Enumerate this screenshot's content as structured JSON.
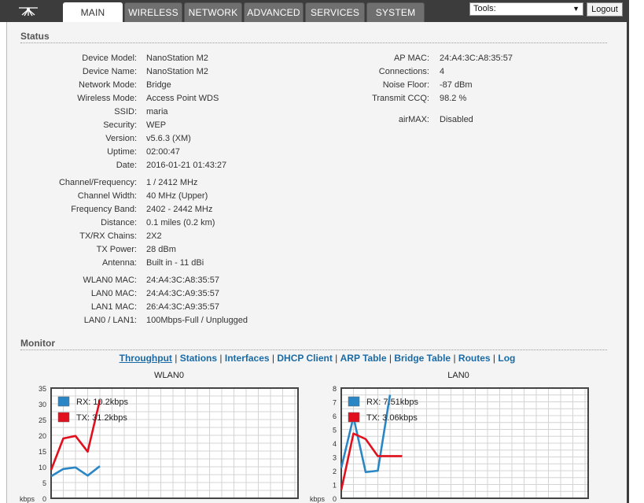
{
  "nav": {
    "tabs": [
      {
        "label": "MAIN",
        "active": true
      },
      {
        "label": "WIRELESS",
        "active": false
      },
      {
        "label": "NETWORK",
        "active": false
      },
      {
        "label": "ADVANCED",
        "active": false
      },
      {
        "label": "SERVICES",
        "active": false
      },
      {
        "label": "SYSTEM",
        "active": false
      }
    ],
    "tools_selected": "Tools:",
    "logout_label": "Logout"
  },
  "status": {
    "title": "Status",
    "left_group1": [
      {
        "label": "Device Model:",
        "value": "NanoStation M2"
      },
      {
        "label": "Device Name:",
        "value": "NanoStation M2"
      },
      {
        "label": "Network Mode:",
        "value": "Bridge"
      },
      {
        "label": "Wireless Mode:",
        "value": "Access Point WDS"
      },
      {
        "label": "SSID:",
        "value": "maria"
      },
      {
        "label": "Security:",
        "value": "WEP"
      },
      {
        "label": "Version:",
        "value": "v5.6.3 (XM)"
      },
      {
        "label": "Uptime:",
        "value": "02:00:47"
      },
      {
        "label": "Date:",
        "value": "2016-01-21 01:43:27"
      }
    ],
    "left_group2": [
      {
        "label": "Channel/Frequency:",
        "value": "1 / 2412 MHz"
      },
      {
        "label": "Channel Width:",
        "value": "40 MHz (Upper)"
      },
      {
        "label": "Frequency Band:",
        "value": "2402 - 2442 MHz"
      },
      {
        "label": "Distance:",
        "value": "0.1 miles (0.2 km)"
      },
      {
        "label": "TX/RX Chains:",
        "value": "2X2"
      },
      {
        "label": "TX Power:",
        "value": "28 dBm"
      },
      {
        "label": "Antenna:",
        "value": "Built in - 11 dBi"
      }
    ],
    "left_group3": [
      {
        "label": "WLAN0 MAC:",
        "value": "24:A4:3C:A8:35:57"
      },
      {
        "label": "LAN0 MAC:",
        "value": "24:A4:3C:A9:35:57"
      },
      {
        "label": "LAN1 MAC:",
        "value": "26:A4:3C:A9:35:57"
      },
      {
        "label": "LAN0 / LAN1:",
        "value": "100Mbps-Full / Unplugged"
      }
    ],
    "right_group1": [
      {
        "label": "AP MAC:",
        "value": "24:A4:3C:A8:35:57"
      },
      {
        "label": "Connections:",
        "value": "4"
      },
      {
        "label": "Noise Floor:",
        "value": "-87 dBm"
      },
      {
        "label": "Transmit CCQ:",
        "value": "98.2 %"
      }
    ],
    "right_group2": [
      {
        "label": "airMAX:",
        "value": "Disabled"
      }
    ]
  },
  "monitor": {
    "title": "Monitor",
    "links": [
      "Throughput",
      "Stations",
      "Interfaces",
      "DHCP Client",
      "ARP Table",
      "Bridge Table",
      "Routes",
      "Log"
    ],
    "selected_link": "Throughput"
  },
  "chart_data": [
    {
      "type": "line",
      "title": "WLAN0",
      "ylabel": "kbps",
      "ylim": [
        0,
        35
      ],
      "yticks": [
        0,
        5,
        10,
        15,
        20,
        25,
        30,
        35
      ],
      "grid": true,
      "legend_placement": "top-left",
      "x": [
        0,
        1,
        2,
        3,
        4,
        5
      ],
      "series": [
        {
          "name": "RX: 10.2kbps",
          "color": "#2a86c4",
          "values": [
            7,
            9.3,
            9.8,
            7.2,
            10.2
          ]
        },
        {
          "name": "TX: 31.2kbps",
          "color": "#e0101e",
          "values": [
            9,
            19,
            19.8,
            14.8,
            31.2
          ]
        }
      ]
    },
    {
      "type": "line",
      "title": "LAN0",
      "ylabel": "kbps",
      "ylim": [
        0,
        8
      ],
      "yticks": [
        0,
        1,
        2,
        3,
        4,
        5,
        6,
        7,
        8
      ],
      "grid": true,
      "legend_placement": "top-left",
      "x": [
        0,
        1,
        2,
        3,
        4,
        5
      ],
      "series": [
        {
          "name": "RX: 7.51kbps",
          "color": "#2a86c4",
          "values": [
            2.2,
            5.9,
            1.9,
            2.0,
            7.51
          ]
        },
        {
          "name": "TX: 3.06kbps",
          "color": "#e0101e",
          "values": [
            0.6,
            4.7,
            4.3,
            3.06,
            3.06,
            3.06
          ]
        }
      ]
    }
  ]
}
